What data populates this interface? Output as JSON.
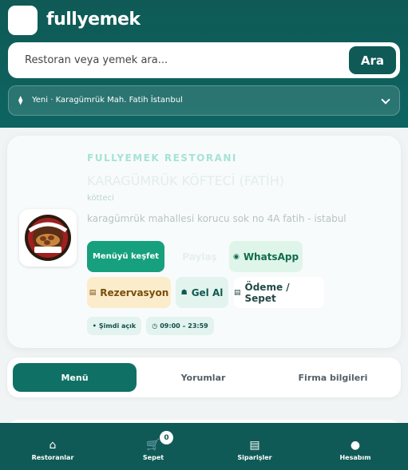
{
  "header": {
    "brand": "fullyemek",
    "search": {
      "placeholder": "Restoran veya yemek ara...",
      "button_label": "Ara"
    },
    "location": {
      "label": "Yeni · Karagümrük Mah. Fatih İstanbul"
    }
  },
  "restaurant": {
    "eyebrow": "FULLYEMEK RESTORANI",
    "name": "KARAGÜMRÜK KÖFTECİ (FATİH)",
    "category": "kötteci",
    "address": "karagümrük mahallesi korucu sok no 4A fatih - istabul",
    "logo_text_top": "KARAGÜMRÜK",
    "logo_text_bottom": "KÖFTECİ",
    "actions": {
      "explore": "Menüyü keşfet",
      "ghost": "Paylaş",
      "whatsapp": "WhatsApp",
      "reservation": "Rezervasyon",
      "gel_al": "Gel Al",
      "payment": "Ödeme / Sepet"
    },
    "status": {
      "open": "Şimdi açık",
      "hours": "09:00 – 23:59"
    }
  },
  "tabs": [
    {
      "label": "Menü",
      "active": true
    },
    {
      "label": "Yorumlar",
      "active": false
    },
    {
      "label": "Firma bilgileri",
      "active": false
    }
  ],
  "bottom_nav": {
    "restaurants": "Restoranlar",
    "cart": "Sepet",
    "cart_count": "0",
    "orders": "Siparişler",
    "account": "Hesabım"
  },
  "colors": {
    "primary": "#0f5a56",
    "accent": "#16a07e",
    "active_tab": "#0f7065"
  }
}
